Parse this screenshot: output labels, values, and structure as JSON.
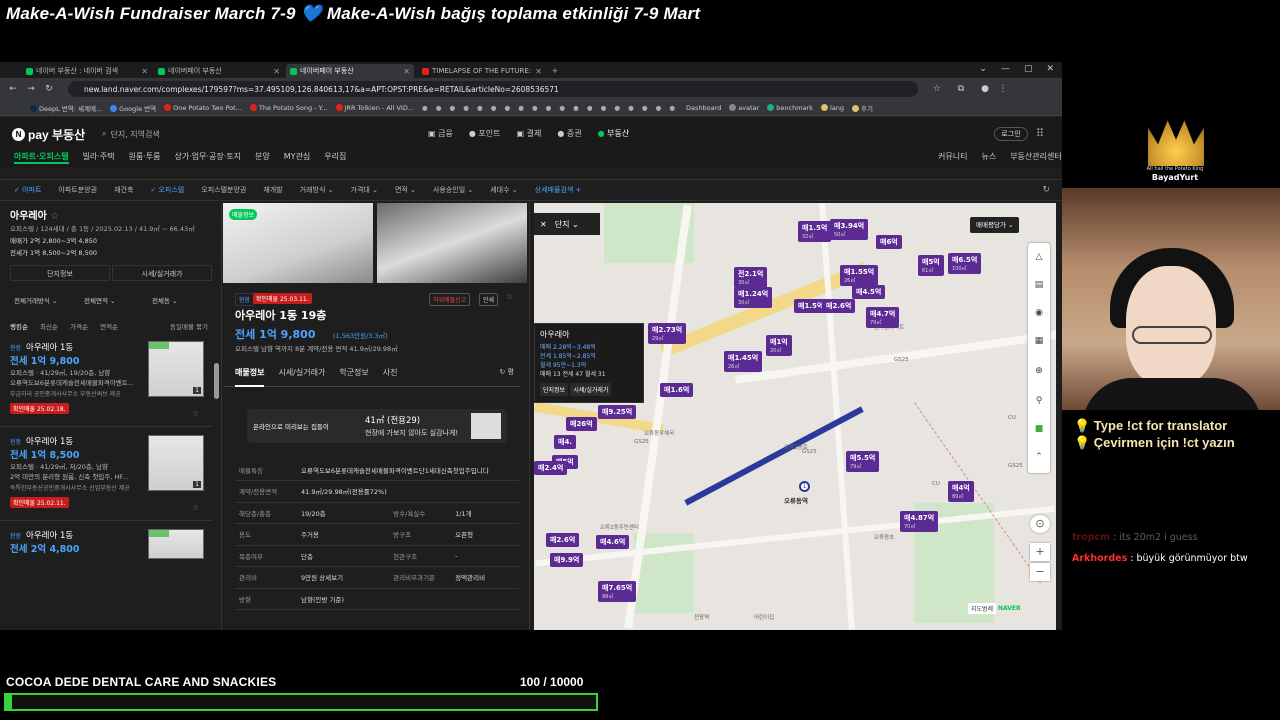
{
  "overlay": {
    "banner_left": "Make-A-Wish Fundraiser March 7-9",
    "banner_heart": "💙",
    "banner_right": "Make-A-Wish bağış toplama etkinliği 7-9 Mart",
    "translator_line1": "💡 Type !ct for translator",
    "translator_line2": "💡 Çevirmen için !ct yazın",
    "crown_caption": "All hail the Potato King",
    "crown_name": "BayadYurt"
  },
  "chat": [
    {
      "user": "tropcm",
      "text": "its 20m2 i guess",
      "faded": true
    },
    {
      "user": "Arkhordes",
      "text": "büyük görünmüyor btw",
      "faded": false
    }
  ],
  "goal": {
    "label": "COCOA DEDE DENTAL CARE AND SNACKIES",
    "current": 100,
    "target": 10000,
    "count_text": "100   / 10000",
    "progress_fraction": 0.01,
    "bar_color": "#36d43a"
  },
  "browser": {
    "tabs": [
      {
        "title": "네이버 부동산 : 네이버 검색",
        "icon": "naver",
        "active": false
      },
      {
        "title": "네이버페이 부동산",
        "icon": "naver",
        "active": false
      },
      {
        "title": "네이버페이 부동산",
        "icon": "naver",
        "active": true
      },
      {
        "title": "TIMELAPSE OF THE FUTURE: A",
        "icon": "youtube",
        "active": false
      }
    ],
    "new_tab": "+",
    "window_controls": [
      "⌄",
      "—",
      "▢",
      "✕"
    ],
    "url": "new.land.naver.com/complexes/179597?ms=37.495109,126.840613,17&a=APT:OPST:PRE&e=RETAIL&articleNo=2608536571",
    "bookmarks": [
      "DeepL 번역: 세계에...",
      "Google 번역",
      "One Potato Two Pot...",
      "The Potato Song - Y...",
      "JRR Tolkien - All VID...",
      "Dashboard",
      "avatar",
      "benchmark",
      "lang",
      "후기"
    ]
  },
  "naver": {
    "logo": "pay 부동산",
    "search_placeholder": "단지, 지역검색",
    "services": [
      "금융",
      "포인트",
      "결제",
      "증권",
      "부동산"
    ],
    "login": "로그인",
    "categories": [
      "아파트·오피스텔",
      "빌라·주택",
      "원룸·투룸",
      "상가·업무·공장·토지",
      "분양",
      "MY관심",
      "우리집"
    ],
    "right_links": [
      "커뮤니티",
      "뉴스",
      "부동산관리센터"
    ],
    "filters": [
      "✓ 아파트",
      "아파트분양권",
      "재건축",
      "✓ 오피스텔",
      "오피스텔분양권",
      "재개발",
      "거래방식 ⌄",
      "가격대 ⌄",
      "면적 ⌄",
      "사용승인일 ⌄",
      "세대수 ⌄",
      "상세매물검색 +"
    ]
  },
  "complex": {
    "name": "아우레아",
    "meta": "오피스텔 / 124세대 / 총 1동 / 2025.02.13 / 41.9㎡ ~ 66.43㎡",
    "sale": "매매가 2억 2,800~3억 4,850",
    "lease": "전세가 1억 8,500~2억 8,500",
    "btn_info": "단지정보",
    "btn_price": "시세/실거래가",
    "dropdowns": [
      "전체거래방식",
      "전체면적",
      "전체동"
    ],
    "sort": [
      "랭킹순",
      "최신순",
      "가격순",
      "면적순"
    ],
    "group_toggle": "동일매물 묶기"
  },
  "listings": [
    {
      "tag": "현장",
      "name": "아우레아 1동",
      "price": "전세 1억 9,800",
      "d1": "오피스텔 · 41/29㎡, 19/20층, 남향",
      "d2": "오류역도보6분롯데캐슬전세매물파격이벤트...",
      "agent": "부금자리 공인중개사사무소   부동산써브 제공",
      "confirm": "확인매물 25.02.18."
    },
    {
      "tag": "현장",
      "name": "아우레아 1동",
      "price": "전세 1억 8,500",
      "d1": "오피스텔 · 41/29㎡, 저/20층, 남향",
      "d2": "2억 미만의 분리형 원룸, 신축 첫입주, HF...",
      "agent": "독특한부동산공인중개사사무소   산업부동산 제공",
      "confirm": "확인매물 25.02.11."
    },
    {
      "tag": "현장",
      "name": "아우레아 1동",
      "price": "전세 2억 4,800",
      "d1": "",
      "d2": "",
      "agent": "",
      "confirm": ""
    }
  ],
  "detail": {
    "photo_badge": "매물정보",
    "tag_site": "현장",
    "tag_confirm": "확인매물 25.03.11.",
    "report": "허위매물신고",
    "print": "인쇄",
    "name": "아우레아 1동 19층",
    "price": "전세 1억 9,800",
    "price_per": "(1,563만원/3.3㎡)",
    "info": "오피스텔   남향   역까지 8분   계약/전용 면적 41.9㎡/29.98㎡",
    "tabs": [
      "매물정보",
      "시세/실거래가",
      "학군정보",
      "사진"
    ],
    "refresh": "↻ 평",
    "promo_left": "온라인으로 미리보는 집들이",
    "promo_area": "41㎡ (전용29)",
    "promo_sub": "현장에 가보지 않아도 실감나게!",
    "table": [
      [
        "매물특징",
        "오류역도보6분롯데캐슬전세매물파격이벤트단1세대신축첫입주입니다",
        "",
        ""
      ],
      [
        "계약/전용면적",
        "41.9㎡/29.98㎡(전용률72%)",
        "",
        ""
      ],
      [
        "해당층/총층",
        "19/20층",
        "방수/욕실수",
        "1/1개"
      ],
      [
        "용도",
        "주거용",
        "방구조",
        "오픈형"
      ],
      [
        "복층여부",
        "단층",
        "현관구조",
        "-"
      ],
      [
        "관리비",
        "9만원 상세보기",
        "관리비부과기준",
        "정액관리비"
      ],
      [
        "방향",
        "남향(안방 기준)",
        "",
        ""
      ]
    ]
  },
  "map": {
    "close": "✕",
    "mode": "단지 ⌄",
    "view_select": "매매평당가 ⌄",
    "popup": {
      "title": "아우레아",
      "sale": "매매 2.28억~3.48억",
      "lease": "전세 1.85억~2.85억",
      "monthly": "월세 95만~1.3억",
      "counts": "매매 13   전세 47   월세 31",
      "btn1": "단지정보",
      "btn2": "시세/실거래가"
    },
    "markers": [
      {
        "text": "매1.5억",
        "sub": "32㎡"
      },
      {
        "text": "매3.94억",
        "sub": "50㎡"
      },
      {
        "text": "매6억",
        "sub": ""
      },
      {
        "text": "매5억",
        "sub": "61㎡"
      },
      {
        "text": "매6.5억",
        "sub": "100㎡"
      },
      {
        "text": "전2.1억",
        "sub": "30㎡"
      },
      {
        "text": "매1.55억",
        "sub": "26㎡"
      },
      {
        "text": "매1.24억",
        "sub": "30㎡"
      },
      {
        "text": "매4.5억",
        "sub": ""
      },
      {
        "text": "매1.5억",
        "sub": ""
      },
      {
        "text": "매2.6억",
        "sub": ""
      },
      {
        "text": "매4.7억",
        "sub": "79㎡"
      },
      {
        "text": "매2.73억",
        "sub": "29㎡"
      },
      {
        "text": "매1억",
        "sub": "20㎡"
      },
      {
        "text": "매1.45억",
        "sub": "26㎡"
      },
      {
        "text": "매1.6억",
        "sub": ""
      },
      {
        "text": "매9.25억",
        "sub": ""
      },
      {
        "text": "매26억",
        "sub": ""
      },
      {
        "text": "매4.",
        "sub": ""
      },
      {
        "text": "매5억",
        "sub": ""
      },
      {
        "text": "매2.4억",
        "sub": ""
      },
      {
        "text": "매5.5억",
        "sub": "79㎡"
      },
      {
        "text": "매4억",
        "sub": "89㎡"
      },
      {
        "text": "매4.87억",
        "sub": "70㎡"
      },
      {
        "text": "매2.6억",
        "sub": ""
      },
      {
        "text": "매4.6억",
        "sub": ""
      },
      {
        "text": "매9.9억",
        "sub": ""
      },
      {
        "text": "매7.65억",
        "sub": "98㎡"
      }
    ],
    "station": "오류동역",
    "places": [
      "GS25",
      "GS25",
      "CU",
      "GS25",
      "CU",
      "GS25",
      "한가람아파트",
      "오류동우체국",
      "오류2동주민센터",
      "오류동초",
      "오류2동로",
      "천왕역",
      "어린이집"
    ],
    "brand": "NAVER",
    "scale": "지도범례"
  }
}
